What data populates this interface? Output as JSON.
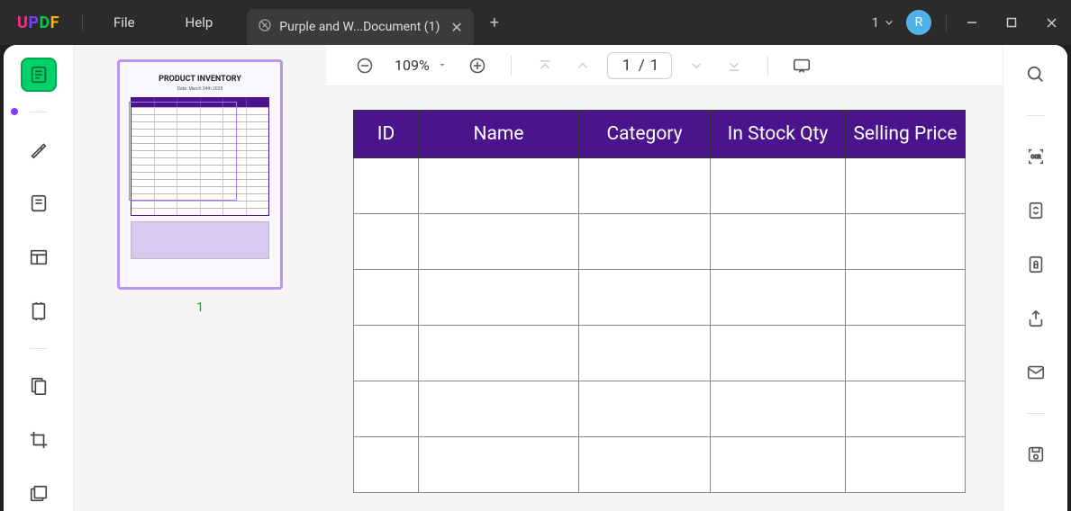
{
  "app": {
    "logo_chars": {
      "u": "U",
      "p": "P",
      "d": "D",
      "f": "F"
    },
    "menu": {
      "file": "File",
      "help": "Help"
    },
    "tab": {
      "title": "Purple and W...Document (1)"
    },
    "tab_count": "1",
    "avatar_letter": "R"
  },
  "toolbar": {
    "zoom": "109%",
    "page_current": "1",
    "page_sep": "/",
    "page_total": "1"
  },
  "thumbnail": {
    "title": "PRODUCT INVENTORY",
    "date": "Date: March 24th 2028",
    "page_label": "1"
  },
  "document": {
    "headers": [
      "ID",
      "Name",
      "Category",
      "In Stock Qty",
      "Selling Price"
    ],
    "row_count": 6
  },
  "colors": {
    "header_bg": "#4a148c",
    "accent": "#7b3dff"
  }
}
